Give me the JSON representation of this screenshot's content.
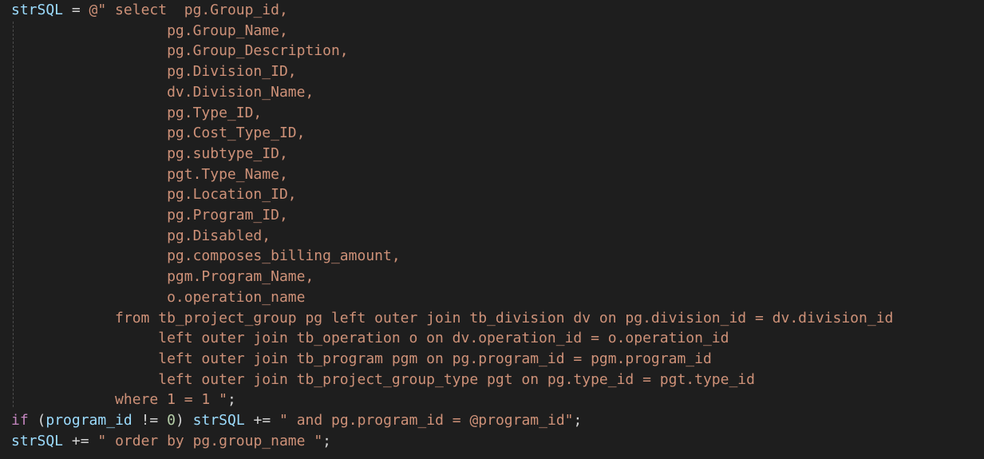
{
  "editor": {
    "lines": [
      [
        {
          "t": "strSQL",
          "c": "var"
        },
        {
          "t": " = ",
          "c": "op"
        },
        {
          "t": "@\" select  pg.Group_id,",
          "c": "str"
        }
      ],
      [
        {
          "t": "                  pg.Group_Name,",
          "c": "str"
        }
      ],
      [
        {
          "t": "                  pg.Group_Description,",
          "c": "str"
        }
      ],
      [
        {
          "t": "                  pg.Division_ID,",
          "c": "str"
        }
      ],
      [
        {
          "t": "                  dv.Division_Name,",
          "c": "str"
        }
      ],
      [
        {
          "t": "                  pg.Type_ID,",
          "c": "str"
        }
      ],
      [
        {
          "t": "                  pg.Cost_Type_ID,",
          "c": "str"
        }
      ],
      [
        {
          "t": "                  pg.subtype_ID,",
          "c": "str"
        }
      ],
      [
        {
          "t": "                  pgt.Type_Name,",
          "c": "str"
        }
      ],
      [
        {
          "t": "                  pg.Location_ID,",
          "c": "str"
        }
      ],
      [
        {
          "t": "                  pg.Program_ID,",
          "c": "str"
        }
      ],
      [
        {
          "t": "                  pg.Disabled,",
          "c": "str"
        }
      ],
      [
        {
          "t": "                  pg.composes_billing_amount,",
          "c": "str"
        }
      ],
      [
        {
          "t": "                  pgm.Program_Name,",
          "c": "str"
        }
      ],
      [
        {
          "t": "                  o.operation_name",
          "c": "str"
        }
      ],
      [
        {
          "t": "            from tb_project_group pg left outer join tb_division dv on pg.division_id = dv.division_id",
          "c": "str"
        }
      ],
      [
        {
          "t": "                 left outer join tb_operation o on dv.operation_id = o.operation_id",
          "c": "str"
        }
      ],
      [
        {
          "t": "                 left outer join tb_program pgm on pg.program_id = pgm.program_id",
          "c": "str"
        }
      ],
      [
        {
          "t": "                 left outer join tb_project_group_type pgt on pg.type_id = pgt.type_id",
          "c": "str"
        }
      ],
      [
        {
          "t": "            where 1 = 1 \"",
          "c": "str"
        },
        {
          "t": ";",
          "c": "punc"
        }
      ],
      [
        {
          "t": "if",
          "c": "kw"
        },
        {
          "t": " (",
          "c": "punc"
        },
        {
          "t": "program_id",
          "c": "var"
        },
        {
          "t": " != ",
          "c": "op"
        },
        {
          "t": "0",
          "c": "num"
        },
        {
          "t": ") ",
          "c": "punc"
        },
        {
          "t": "strSQL",
          "c": "var"
        },
        {
          "t": " += ",
          "c": "op"
        },
        {
          "t": "\" and pg.program_id = @program_id\"",
          "c": "str"
        },
        {
          "t": ";",
          "c": "punc"
        }
      ],
      [
        {
          "t": "strSQL",
          "c": "var"
        },
        {
          "t": " += ",
          "c": "op"
        },
        {
          "t": "\" order by pg.group_name \"",
          "c": "str"
        },
        {
          "t": ";",
          "c": "punc"
        }
      ]
    ]
  }
}
